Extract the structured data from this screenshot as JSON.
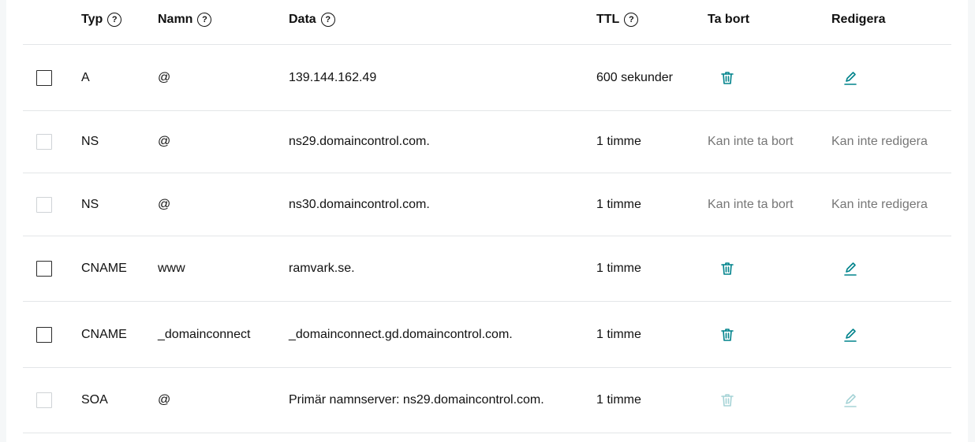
{
  "columns": {
    "typ": "Typ",
    "namn": "Namn",
    "data": "Data",
    "ttl": "TTL",
    "ta_bort": "Ta bort",
    "redigera": "Redigera"
  },
  "icons": {
    "help": "help-circle-icon",
    "delete": "trash-icon",
    "edit": "pencil-icon"
  },
  "colors": {
    "accent": "#00838c",
    "muted_text": "#767676",
    "divider": "#e3e6e8"
  },
  "rows": [
    {
      "typ": "A",
      "namn": "@",
      "data": "139.144.162.49",
      "ttl": "600 sekunder",
      "editable": true,
      "ta_bort": "",
      "redigera": ""
    },
    {
      "typ": "NS",
      "namn": "@",
      "data": "ns29.domaincontrol.com.",
      "ttl": "1 timme",
      "editable": false,
      "ta_bort": "Kan inte ta bort",
      "redigera": "Kan inte redigera"
    },
    {
      "typ": "NS",
      "namn": "@",
      "data": "ns30.domaincontrol.com.",
      "ttl": "1 timme",
      "editable": false,
      "ta_bort": "Kan inte ta bort",
      "redigera": "Kan inte redigera"
    },
    {
      "typ": "CNAME",
      "namn": "www",
      "data": "ramvark.se.",
      "ttl": "1 timme",
      "editable": true,
      "ta_bort": "",
      "redigera": ""
    },
    {
      "typ": "CNAME",
      "namn": "_domainconnect",
      "data": "_domainconnect.gd.domaincontrol.com.",
      "ttl": "1 timme",
      "editable": true,
      "ta_bort": "",
      "redigera": ""
    },
    {
      "typ": "SOA",
      "namn": "@",
      "data": "Primär namnserver: ns29.domaincontrol.com.",
      "ttl": "1 timme",
      "editable": false,
      "ta_bort": "",
      "redigera": ""
    }
  ]
}
